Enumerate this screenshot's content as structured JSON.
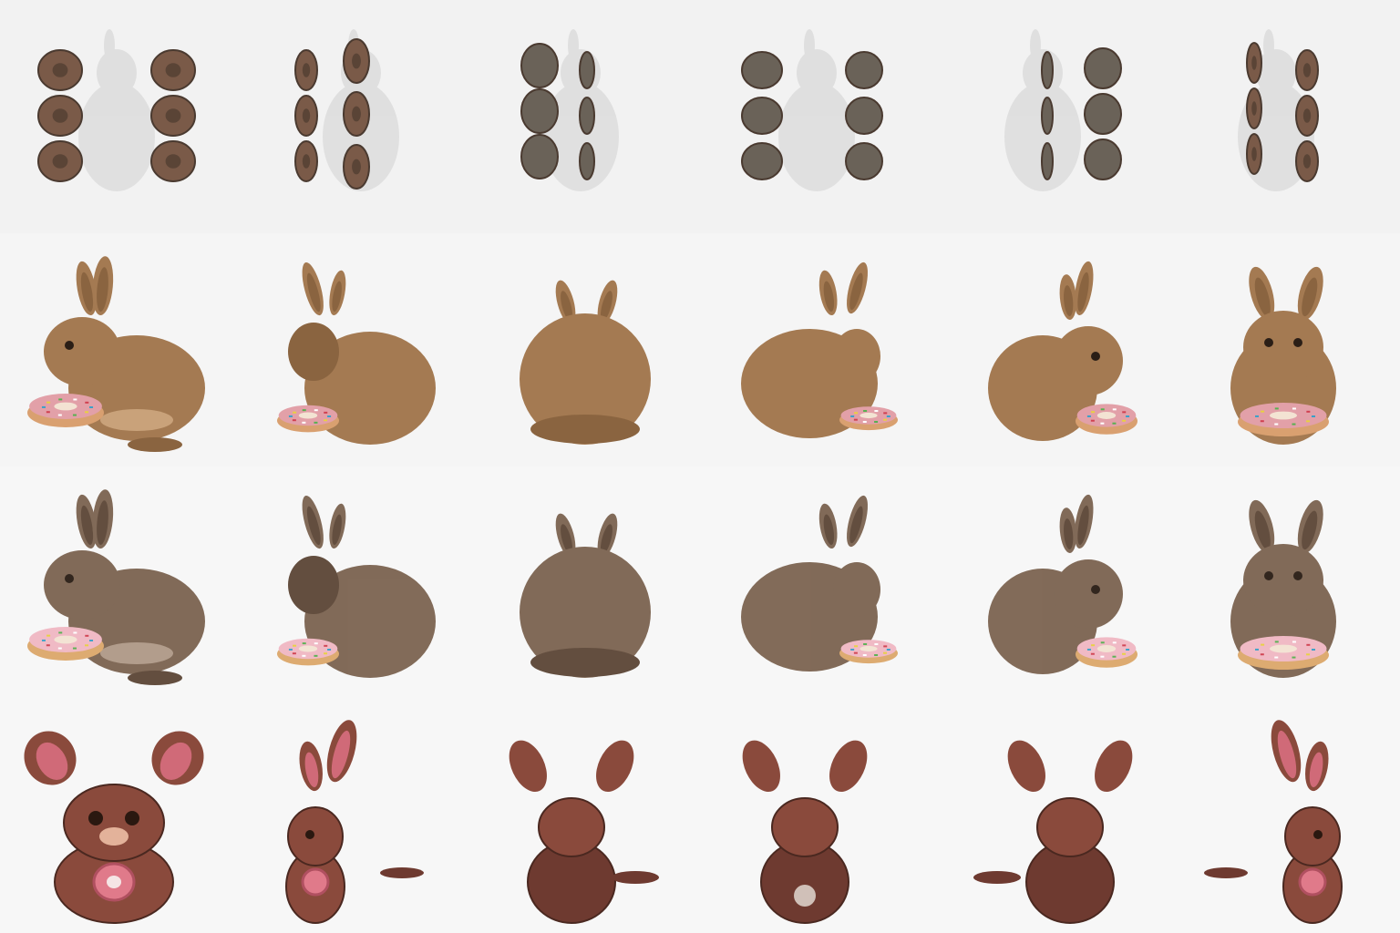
{
  "grid": {
    "rows": 4,
    "columns": 6
  },
  "rows": [
    {
      "subject": "donut-rings",
      "colors": {
        "body": "#6e5746",
        "plain": "#6a6258",
        "icing": "#7a5a48",
        "ghost": "#d8d8d8",
        "bg": "#f2f2f2"
      },
      "views": [
        "front",
        "front-left",
        "left",
        "back",
        "right",
        "front-right"
      ]
    },
    {
      "subject": "bunny-with-donut",
      "colors": {
        "body": "#a47a52",
        "dark": "#8a6440",
        "light": "#c9a27a",
        "donut": "#d9a070",
        "icing": "#e2a0a8",
        "bg": "#f5f5f5"
      },
      "views": [
        "side",
        "back-left",
        "back",
        "back-right",
        "side-right",
        "front"
      ]
    },
    {
      "subject": "realistic-bunny-with-donut",
      "colors": {
        "body": "#7d6552",
        "dark": "#5e4838",
        "light": "#b09a88",
        "donut": "#dca86c",
        "icing": "#f0b8c4",
        "bg": "#f7f7f7"
      },
      "views": [
        "side",
        "back-left",
        "back",
        "back-right",
        "side-right",
        "front"
      ]
    },
    {
      "subject": "cartoon-bunny-with-donut",
      "colors": {
        "body": "#8a4a3c",
        "dark": "#6e3a30",
        "ear_inner": "#d06a78",
        "light": "#e3b29a",
        "donut": "#e07a8a",
        "bg": "#f7f7f7"
      },
      "views": [
        "front",
        "side-left",
        "back",
        "back-wide",
        "back-right",
        "side-right"
      ]
    }
  ]
}
